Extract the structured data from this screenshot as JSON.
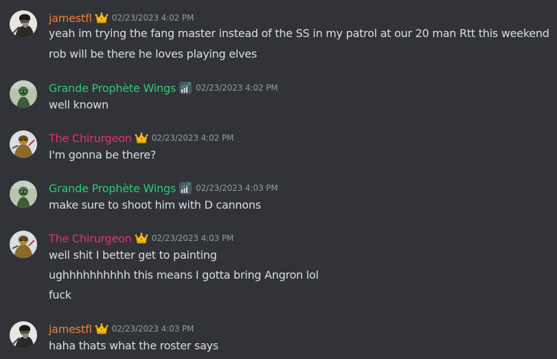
{
  "colors": {
    "background": "#313338",
    "message_text": "#dbdee1",
    "timestamp": "#949ba4",
    "jamestfl": "#f0803c",
    "grande": "#2ecc71",
    "chirurgeon": "#e0356a"
  },
  "messages": [
    {
      "author": "jamestfl",
      "role_icon": "crown-icon",
      "timestamp": "02/23/2023 4:02 PM",
      "lines": [
        "yeah im trying the fang master instead of the SS in my patrol at our 20 man Rtt this weekend",
        "rob will be there he loves playing elves"
      ]
    },
    {
      "author": "Grande Prophète Wings",
      "role_icon": "trophy-chart-icon",
      "timestamp": "02/23/2023 4:02 PM",
      "lines": [
        "well known"
      ]
    },
    {
      "author": "The Chirurgeon",
      "role_icon": "crown-icon",
      "timestamp": "02/23/2023 4:02 PM",
      "lines": [
        "I'm gonna be there?"
      ]
    },
    {
      "author": "Grande Prophète Wings",
      "role_icon": "trophy-chart-icon",
      "timestamp": "02/23/2023 4:03 PM",
      "lines": [
        "make sure to shoot him with D cannons"
      ]
    },
    {
      "author": "The Chirurgeon",
      "role_icon": "crown-icon",
      "timestamp": "02/23/2023 4:03 PM",
      "lines": [
        "well shit I better get to painting",
        "ughhhhhhhhhh this means I gotta bring Angron lol",
        "fuck"
      ]
    },
    {
      "author": "jamestfl",
      "role_icon": "crown-icon",
      "timestamp": "02/23/2023 4:03 PM",
      "lines": [
        "haha thats what the roster says"
      ]
    }
  ]
}
